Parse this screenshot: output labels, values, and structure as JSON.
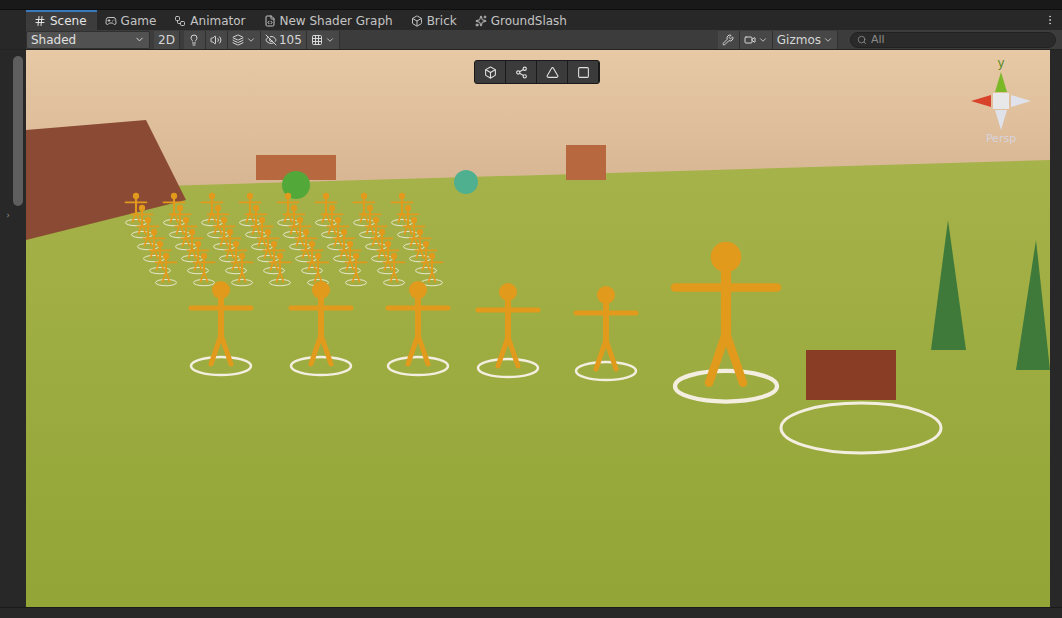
{
  "tabs": [
    {
      "label": "Scene",
      "selected": true
    },
    {
      "label": "Game",
      "selected": false
    },
    {
      "label": "Animator",
      "selected": false
    },
    {
      "label": "New Shader Graph",
      "selected": false
    },
    {
      "label": "Brick",
      "selected": false
    },
    {
      "label": "GroundSlash",
      "selected": false
    }
  ],
  "toolbar": {
    "draw_mode": "Shaded",
    "mode_2d": "2D",
    "hidden_count": "105",
    "gizmos": "Gizmos",
    "search": {
      "placeholder": "All"
    }
  },
  "scene": {
    "axis_label": "y",
    "projection": "Persp"
  }
}
